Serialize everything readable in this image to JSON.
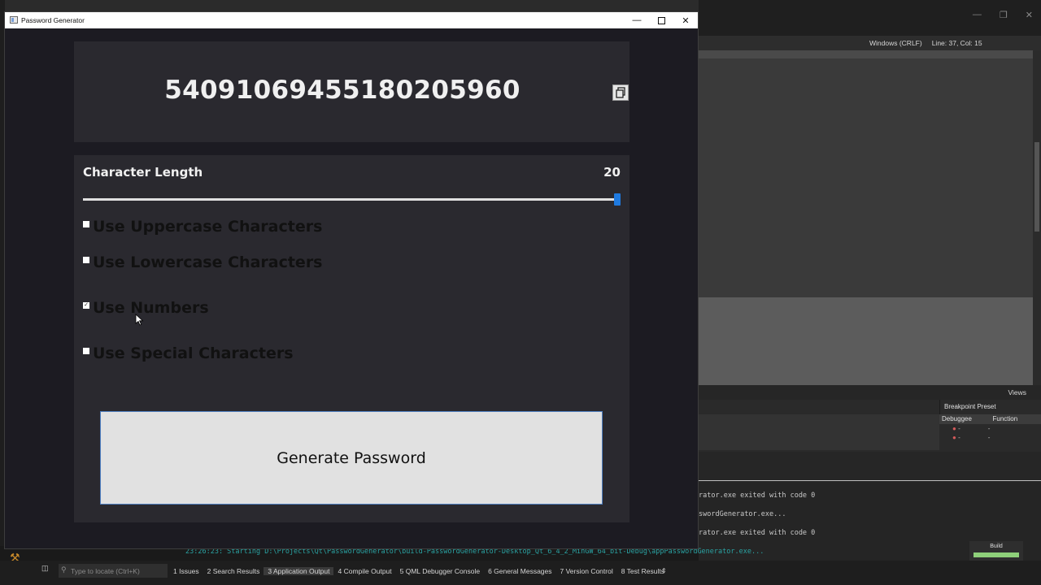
{
  "ide": {
    "editor_toolbar": {
      "line_ending": "Windows (CRLF)",
      "position": "Line: 37, Col: 15"
    },
    "views_label": "Views",
    "breakpoint_preset": "Breakpoint Preset",
    "breakpoint_columns": [
      "Debuggee",
      "Function"
    ],
    "breakpoint_rows": [
      {
        "debuggee": "-",
        "function": "-"
      },
      {
        "debuggee": "-",
        "function": "-"
      }
    ],
    "output_lines": [
      "rator.exe exited with code 0",
      "swordGenerator.exe...",
      "rator.exe exited with code 0",
      "23:26:23: Starting D:\\Projects\\Qt\\PasswordGenerator\\build-PasswordGenerator-Desktop_Qt_6_4_2_MinGW_64_bit-Debug\\appPasswordGenerator.exe..."
    ],
    "build_label": "Build",
    "locate_placeholder": "Type to locate (Ctrl+K)",
    "status_tabs": [
      {
        "label": "1  Issues",
        "active": false
      },
      {
        "label": "2  Search Results",
        "active": false
      },
      {
        "label": "3  Application Output",
        "active": true
      },
      {
        "label": "4  Compile Output",
        "active": false
      },
      {
        "label": "5  QML Debugger Console",
        "active": false
      },
      {
        "label": "6  General Messages",
        "active": false
      },
      {
        "label": "7  Version Control",
        "active": false
      },
      {
        "label": "8  Test Results",
        "active": false
      }
    ]
  },
  "app": {
    "title": "Password Generator",
    "password": "54091069455180205960",
    "length_label": "Character Length",
    "length_value": "20",
    "length_fraction": 1.0,
    "options": [
      {
        "label": "Use Uppercase Characters",
        "checked": false
      },
      {
        "label": "Use Lowercase Characters",
        "checked": false
      },
      {
        "label": "Use Numbers",
        "checked": true
      },
      {
        "label": "Use Special Characters",
        "checked": false
      }
    ],
    "generate_label": "Generate Password"
  },
  "colors": {
    "app_bg": "#1c1b22",
    "panel_bg": "#2a292f",
    "slider_handle": "#1f7ae0",
    "button_border": "#4f7fc1",
    "build_progress": "#8ed07a"
  },
  "icons": [
    "copy-icon",
    "minimize-icon",
    "maximize-icon",
    "close-icon",
    "search-icon",
    "hammer-icon",
    "mouse-cursor-icon"
  ]
}
